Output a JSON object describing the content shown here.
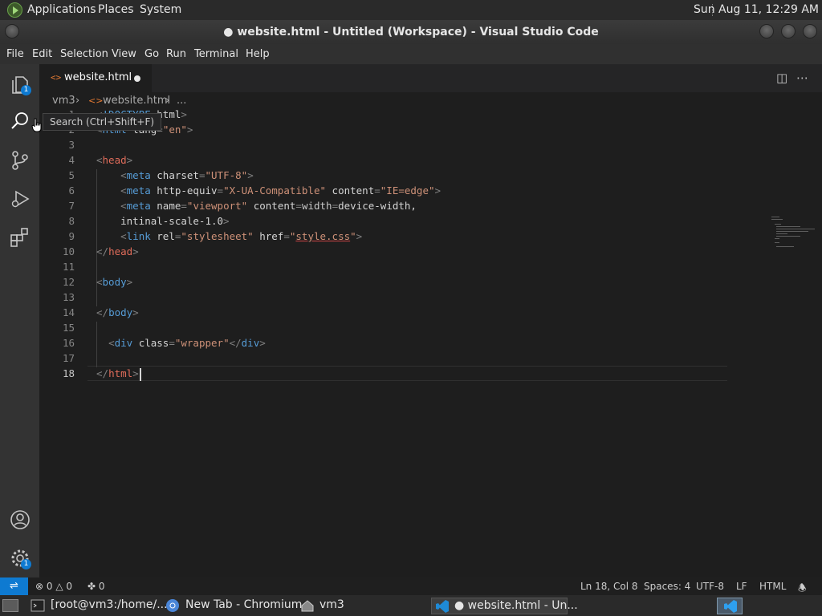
{
  "top_panel": {
    "menus": [
      "Applications",
      "Places",
      "System"
    ],
    "clock": "Sun Aug 11, 12:29 AM"
  },
  "window": {
    "title": "● website.html - Untitled (Workspace) - Visual Studio Code"
  },
  "menubar": [
    "File",
    "Edit",
    "Selection",
    "View",
    "Go",
    "Run",
    "Terminal",
    "Help"
  ],
  "activity_bar": {
    "explorer_badge": "1",
    "settings_badge": "1"
  },
  "tab": {
    "label": "website.html",
    "icon": "<>"
  },
  "breadcrumbs": {
    "folder": "vm3",
    "file": "website.html",
    "more": "..."
  },
  "tooltip": "Search (Ctrl+Shift+F)",
  "editor": {
    "lines": [
      {
        "n": "1",
        "text": "<!DOCTYPE html>"
      },
      {
        "n": "2",
        "text": "<html lang=\"en\">"
      },
      {
        "n": "3",
        "text": ""
      },
      {
        "n": "4",
        "text": "<head>"
      },
      {
        "n": "5",
        "text": "    <meta charset=\"UTF-8\">"
      },
      {
        "n": "6",
        "text": "    <meta http-equiv=\"X-UA-Compatible\" content=\"IE=edge\">"
      },
      {
        "n": "7",
        "text": "    <meta name=\"viewport\" content=\"width=device-width,"
      },
      {
        "n": "8",
        "text": "    intinal-scale-1.0\">"
      },
      {
        "n": "9",
        "text": "    <link rel=\"stylesheet\" href=\"style.css\">"
      },
      {
        "n": "10",
        "text": "</head>"
      },
      {
        "n": "11",
        "text": ""
      },
      {
        "n": "12",
        "text": "<body>"
      },
      {
        "n": "13",
        "text": ""
      },
      {
        "n": "14",
        "text": "</body>"
      },
      {
        "n": "15",
        "text": ""
      },
      {
        "n": "16",
        "text": "  <div class=\"wrapper\"</div>"
      },
      {
        "n": "17",
        "text": ""
      },
      {
        "n": "18",
        "text": "</html>"
      }
    ]
  },
  "statusbar": {
    "errors": "0",
    "warnings": "0",
    "ports": "0",
    "position": "Ln 18, Col 8",
    "spaces": "Spaces: 4",
    "encoding": "UTF-8",
    "eol": "LF",
    "language": "HTML"
  },
  "taskbar": {
    "items": [
      {
        "label": "[root@vm3:/home/..."
      },
      {
        "label": "New Tab - Chromium"
      },
      {
        "label": "vm3"
      },
      {
        "label": "● website.html - Un..."
      }
    ]
  },
  "colors": {
    "accent": "#0e7ad1",
    "editor_bg": "#1e1e1e",
    "tag": "#569cd6",
    "string": "#ce9178"
  }
}
